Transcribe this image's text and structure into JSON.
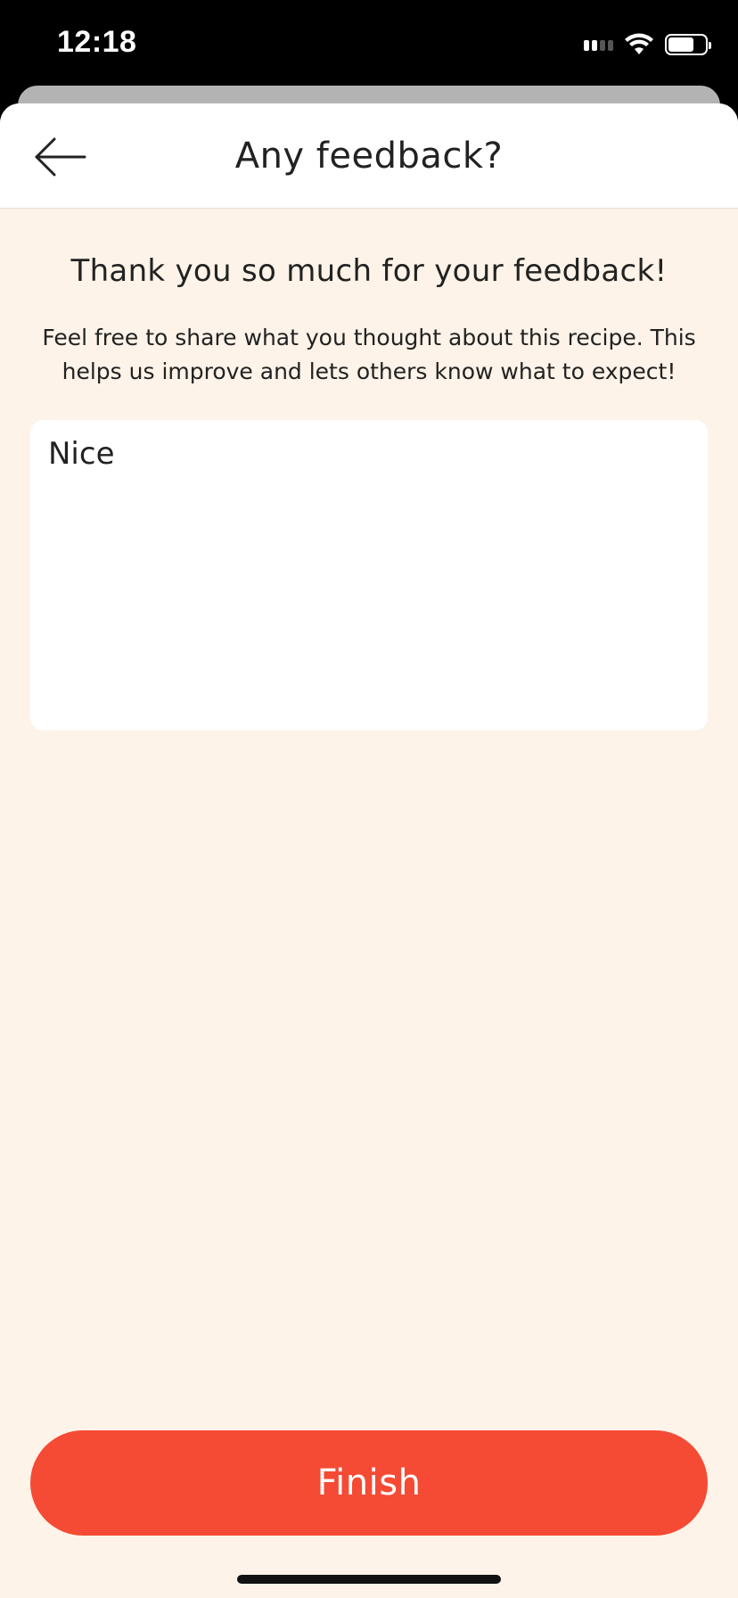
{
  "status_bar": {
    "time": "12:18",
    "icons": [
      "cellular-signal-icon",
      "wifi-icon",
      "battery-icon"
    ],
    "battery_level": 0.7
  },
  "header": {
    "back_icon": "arrow-left-icon",
    "title": "Any feedback?"
  },
  "content": {
    "thank_you": "Thank you so much for your feedback!",
    "description": "Feel free to share what you thought about this recipe. This helps us improve and lets others know what to expect!",
    "feedback_value": "Nice"
  },
  "actions": {
    "finish_label": "Finish"
  },
  "colors": {
    "background": "#fdf3e8",
    "accent": "#f54a34",
    "text": "#222222"
  }
}
